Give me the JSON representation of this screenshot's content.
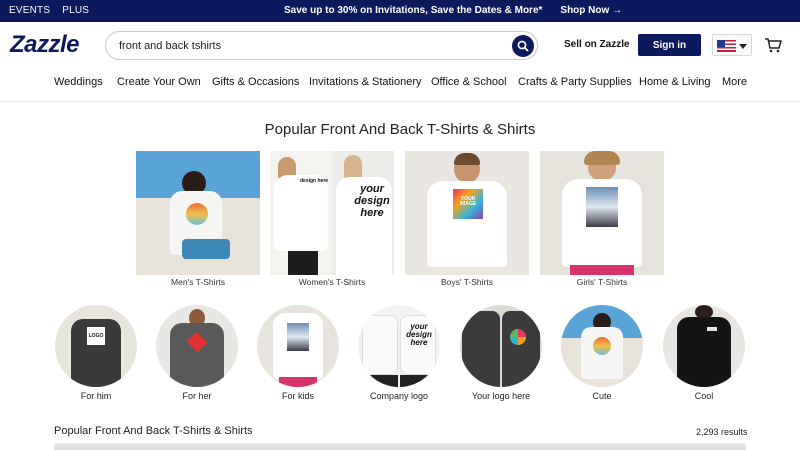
{
  "promo": {
    "links": [
      "EVENTS",
      "PLUS"
    ],
    "message": "Save up to 30% on Invitations, Save the Dates & More*",
    "cta": "Shop Now →"
  },
  "header": {
    "logo": "Zazzle",
    "search_value": "front and back tshirts",
    "sell_label": "Sell on Zazzle",
    "signin_label": "Sign in"
  },
  "nav": {
    "items": [
      "Weddings",
      "Create Your Own",
      "Gifts & Occasions",
      "Invitations & Stationery",
      "Office & School",
      "Crafts & Party Supplies",
      "Home & Living",
      "More"
    ]
  },
  "main": {
    "title": "Popular Front And Back T-Shirts & Shirts",
    "tiles": [
      {
        "label": "Men's T-Shirts"
      },
      {
        "label": "Women's T-Shirts",
        "print_text": "your design here",
        "small_text": "design here"
      },
      {
        "label": "Boys' T-Shirts",
        "print_text": "YOUR IMAGE"
      },
      {
        "label": "Girls' T-Shirts"
      }
    ],
    "circles": [
      {
        "label": "For him",
        "print_text": "LOGO"
      },
      {
        "label": "For her"
      },
      {
        "label": "For kids"
      },
      {
        "label": "Company logo",
        "print_text": "your design here"
      },
      {
        "label": "Your logo here"
      },
      {
        "label": "Cute"
      },
      {
        "label": "Cool"
      }
    ],
    "results_title": "Popular Front And Back T-Shirts & Shirts",
    "results_count": "2,293 results"
  },
  "colors": {
    "brand_navy": "#0b1a5c"
  }
}
